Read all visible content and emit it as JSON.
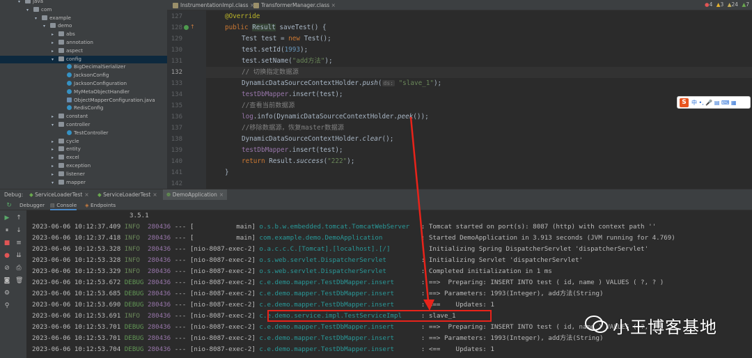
{
  "tree": {
    "items": [
      {
        "label": "java",
        "indent": 40,
        "type": "folder",
        "arrow": "▾"
      },
      {
        "label": "com",
        "indent": 52,
        "type": "folder",
        "arrow": "▾"
      },
      {
        "label": "example",
        "indent": 64,
        "type": "folder",
        "arrow": "▾"
      },
      {
        "label": "demo",
        "indent": 76,
        "type": "folder",
        "arrow": "▾"
      },
      {
        "label": "abs",
        "indent": 88,
        "type": "folder",
        "arrow": "▸"
      },
      {
        "label": "annotation",
        "indent": 88,
        "type": "folder",
        "arrow": "▸"
      },
      {
        "label": "aspect",
        "indent": 88,
        "type": "folder",
        "arrow": "▸"
      },
      {
        "label": "config",
        "indent": 88,
        "type": "folder",
        "arrow": "▾"
      },
      {
        "label": "BigDecimalSerializer",
        "indent": 100,
        "type": "cls",
        "arrow": ""
      },
      {
        "label": "JacksonConfig",
        "indent": 100,
        "type": "cls",
        "arrow": ""
      },
      {
        "label": "JacksonConfiguration",
        "indent": 100,
        "type": "cls",
        "arrow": ""
      },
      {
        "label": "MyMetaObjectHandler",
        "indent": 100,
        "type": "cls",
        "arrow": ""
      },
      {
        "label": "ObjectMapperConfiguration.java",
        "indent": 100,
        "type": "java",
        "arrow": ""
      },
      {
        "label": "RedisConfig",
        "indent": 100,
        "type": "cls",
        "arrow": ""
      },
      {
        "label": "constant",
        "indent": 88,
        "type": "folder",
        "arrow": "▸"
      },
      {
        "label": "controller",
        "indent": 88,
        "type": "folder",
        "arrow": "▾"
      },
      {
        "label": "TestController",
        "indent": 100,
        "type": "cls",
        "arrow": ""
      },
      {
        "label": "cycle",
        "indent": 88,
        "type": "folder",
        "arrow": "▸"
      },
      {
        "label": "entity",
        "indent": 88,
        "type": "folder",
        "arrow": "▸"
      },
      {
        "label": "excel",
        "indent": 88,
        "type": "folder",
        "arrow": "▸"
      },
      {
        "label": "exception",
        "indent": 88,
        "type": "folder",
        "arrow": "▸"
      },
      {
        "label": "listener",
        "indent": 88,
        "type": "folder",
        "arrow": "▸"
      },
      {
        "label": "mapper",
        "indent": 88,
        "type": "folder",
        "arrow": "▾"
      }
    ]
  },
  "editor": {
    "tabs": [
      "InstrumentationImpl.class",
      "TransformerManager.class"
    ],
    "inspections": {
      "errors": "4",
      "warnings": "3",
      "weak": "24",
      "typos": "7"
    },
    "line_numbers": [
      "127",
      "128",
      "129",
      "130",
      "131",
      "132",
      "133",
      "134",
      "135",
      "136",
      "137",
      "138",
      "139",
      "140",
      "141",
      "142"
    ],
    "current_line": "132",
    "code": {
      "l127": "@Override",
      "l128_kw": "public",
      "l128_type": "Result",
      "l128_rest": " saveTest() {",
      "l129_a": "Test test = ",
      "l129_kw": "new",
      "l129_b": " Test();",
      "l130_a": "test.setId(",
      "l130_num": "1993",
      "l130_b": ");",
      "l131_a": "test.setName(",
      "l131_str": "\"add方法\"",
      "l131_b": ");",
      "l132": "// 切换指定数据源",
      "l133_a": "DynamicDataSourceContextHolder.",
      "l133_m": "push",
      "l133_b": "(",
      "l133_hint": "ds:",
      "l133_str": "\"slave_1\"",
      "l133_c": ");",
      "l134_f": "testDbMapper",
      "l134_b": ".insert(test);",
      "l135": "//查看当前数据源",
      "l136_f": "log",
      "l136_a": ".info(DynamicDataSourceContextHolder.",
      "l136_m": "peek",
      "l136_b": "());",
      "l137": "//移除数据源，恢复master数据源",
      "l138_a": "DynamicDataSourceContextHolder.",
      "l138_m": "clear",
      "l138_b": "();",
      "l139_f": "testDbMapper",
      "l139_b": ".insert(test);",
      "l140_kw": "return",
      "l140_a": " Result.",
      "l140_m": "success",
      "l140_b": "(",
      "l140_str": "\"222\"",
      "l140_c": ");",
      "l141": "}"
    }
  },
  "ime": {
    "logo": "S",
    "items": "中 •, 🎤 ▤ ⌨ ▦"
  },
  "debug": {
    "label": "Debug:",
    "tabs": [
      "ServiceLoaderTest",
      "ServiceLoaderTest",
      "DemoApplication"
    ],
    "subtabs": [
      "Debugger",
      "Console",
      "Endpoints"
    ]
  },
  "console": {
    "version": "3.5.1",
    "lines": [
      {
        "ts": "2023-06-06 10:12:37.409",
        "lvl": "INFO ",
        "pid": "280436",
        "sep": "---",
        "thr": "[           main]",
        "logger": "o.s.b.w.embedded.tomcat.TomcatWebServer  ",
        "msg": ": Tomcat started on port(s): 8087 (http) with context path ''"
      },
      {
        "ts": "2023-06-06 10:12:37.418",
        "lvl": "INFO ",
        "pid": "280436",
        "sep": "---",
        "thr": "[           main]",
        "logger": "com.example.demo.DemoApplication         ",
        "msg": ": Started DemoApplication in 3.913 seconds (JVM running for 4.769)"
      },
      {
        "ts": "2023-06-06 10:12:53.328",
        "lvl": "INFO ",
        "pid": "280436",
        "sep": "---",
        "thr": "[nio-8087-exec-2]",
        "logger": "o.a.c.c.C.[Tomcat].[localhost].[/]       ",
        "msg": ": Initializing Spring DispatcherServlet 'dispatcherServlet'"
      },
      {
        "ts": "2023-06-06 10:12:53.328",
        "lvl": "INFO ",
        "pid": "280436",
        "sep": "---",
        "thr": "[nio-8087-exec-2]",
        "logger": "o.s.web.servlet.DispatcherServlet        ",
        "msg": ": Initializing Servlet 'dispatcherServlet'"
      },
      {
        "ts": "2023-06-06 10:12:53.329",
        "lvl": "INFO ",
        "pid": "280436",
        "sep": "---",
        "thr": "[nio-8087-exec-2]",
        "logger": "o.s.web.servlet.DispatcherServlet        ",
        "msg": ": Completed initialization in 1 ms"
      },
      {
        "ts": "2023-06-06 10:12:53.672",
        "lvl": "DEBUG",
        "pid": "280436",
        "sep": "---",
        "thr": "[nio-8087-exec-2]",
        "logger": "c.e.demo.mapper.TestDbMapper.insert      ",
        "msg": ": ==>  Preparing: INSERT INTO test ( id, name ) VALUES ( ?, ? )"
      },
      {
        "ts": "2023-06-06 10:12:53.685",
        "lvl": "DEBUG",
        "pid": "280436",
        "sep": "---",
        "thr": "[nio-8087-exec-2]",
        "logger": "c.e.demo.mapper.TestDbMapper.insert      ",
        "msg": ": ==> Parameters: 1993(Integer), add方法(String)"
      },
      {
        "ts": "2023-06-06 10:12:53.690",
        "lvl": "DEBUG",
        "pid": "280436",
        "sep": "---",
        "thr": "[nio-8087-exec-2]",
        "logger": "c.e.demo.mapper.TestDbMapper.insert      ",
        "msg": ": <==    Updates: 1"
      },
      {
        "ts": "2023-06-06 10:12:53.691",
        "lvl": "INFO ",
        "pid": "280436",
        "sep": "---",
        "thr": "[nio-8087-exec-2]",
        "logger": "c.e.demo.service.impl.TestServiceImpl    ",
        "msg": ": slave_1"
      },
      {
        "ts": "2023-06-06 10:12:53.701",
        "lvl": "DEBUG",
        "pid": "280436",
        "sep": "---",
        "thr": "[nio-8087-exec-2]",
        "logger": "c.e.demo.mapper.TestDbMapper.insert      ",
        "msg": ": ==>  Preparing: INSERT INTO test ( id, name ) VALUES ( ?, ? )"
      },
      {
        "ts": "2023-06-06 10:12:53.701",
        "lvl": "DEBUG",
        "pid": "280436",
        "sep": "---",
        "thr": "[nio-8087-exec-2]",
        "logger": "c.e.demo.mapper.TestDbMapper.insert      ",
        "msg": ": ==> Parameters: 1993(Integer), add方法(String)"
      },
      {
        "ts": "2023-06-06 10:12:53.704",
        "lvl": "DEBUG",
        "pid": "280436",
        "sep": "---",
        "thr": "[nio-8087-exec-2]",
        "logger": "c.e.demo.mapper.TestDbMapper.insert      ",
        "msg": ": <==    Updates: 1"
      }
    ]
  },
  "watermark": "小王博客基地",
  "colors": {
    "highlight_box": "#e8231a",
    "arrow": "#e8231a",
    "selection": "#0d293e"
  }
}
